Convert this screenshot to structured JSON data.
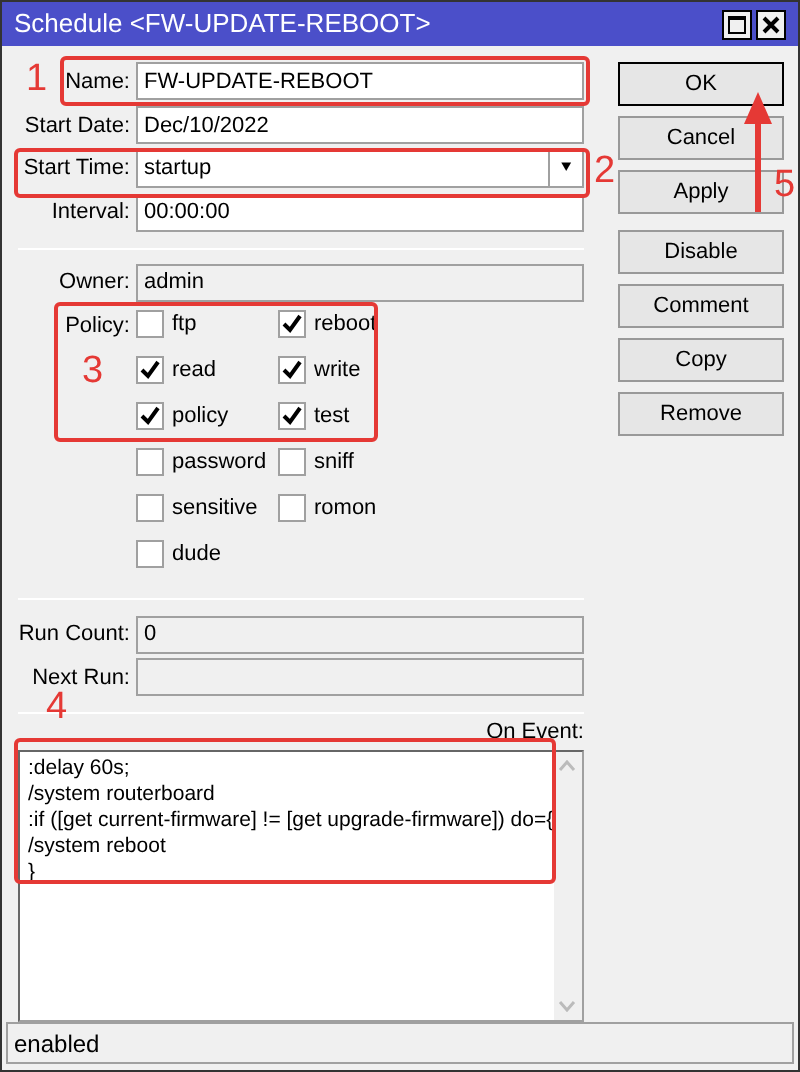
{
  "window": {
    "title": "Schedule <FW-UPDATE-REBOOT>"
  },
  "fields": [
    {
      "label": "Name:",
      "value": "FW-UPDATE-REBOOT"
    },
    {
      "label": "Start Date:",
      "value": "Dec/10/2022"
    },
    {
      "label": "Start Time:",
      "value": "startup",
      "kind": "dropdown",
      "dropdown_icon": "⯆"
    },
    {
      "label": "Interval:",
      "value": "00:00:00"
    }
  ],
  "owner": {
    "label": "Owner:",
    "value": "admin"
  },
  "policy": {
    "label": "Policy:",
    "items": [
      {
        "label": "ftp",
        "checked": false
      },
      {
        "label": "reboot",
        "checked": true
      },
      {
        "label": "read",
        "checked": true
      },
      {
        "label": "write",
        "checked": true
      },
      {
        "label": "policy",
        "checked": true
      },
      {
        "label": "test",
        "checked": true
      },
      {
        "label": "password",
        "checked": false
      },
      {
        "label": "sniff",
        "checked": false
      },
      {
        "label": "sensitive",
        "checked": false
      },
      {
        "label": "romon",
        "checked": false
      },
      {
        "label": "dude",
        "checked": false
      }
    ]
  },
  "stats": [
    {
      "label": "Run Count:",
      "value": "0"
    },
    {
      "label": "Next Run:"
    }
  ],
  "on_event": {
    "label": "On Event:",
    "lines": [
      ":delay 60s;",
      "/system routerboard",
      ":if ([get current-firmware] != [get upgrade-firmware]) do={",
      "/system reboot",
      "}"
    ]
  },
  "buttons": [
    "OK",
    "Cancel",
    "Apply",
    "Disable",
    "Comment",
    "Copy",
    "Remove"
  ],
  "status_bar": "enabled",
  "annotations": [
    "1",
    "2",
    "3",
    "4",
    "5"
  ]
}
